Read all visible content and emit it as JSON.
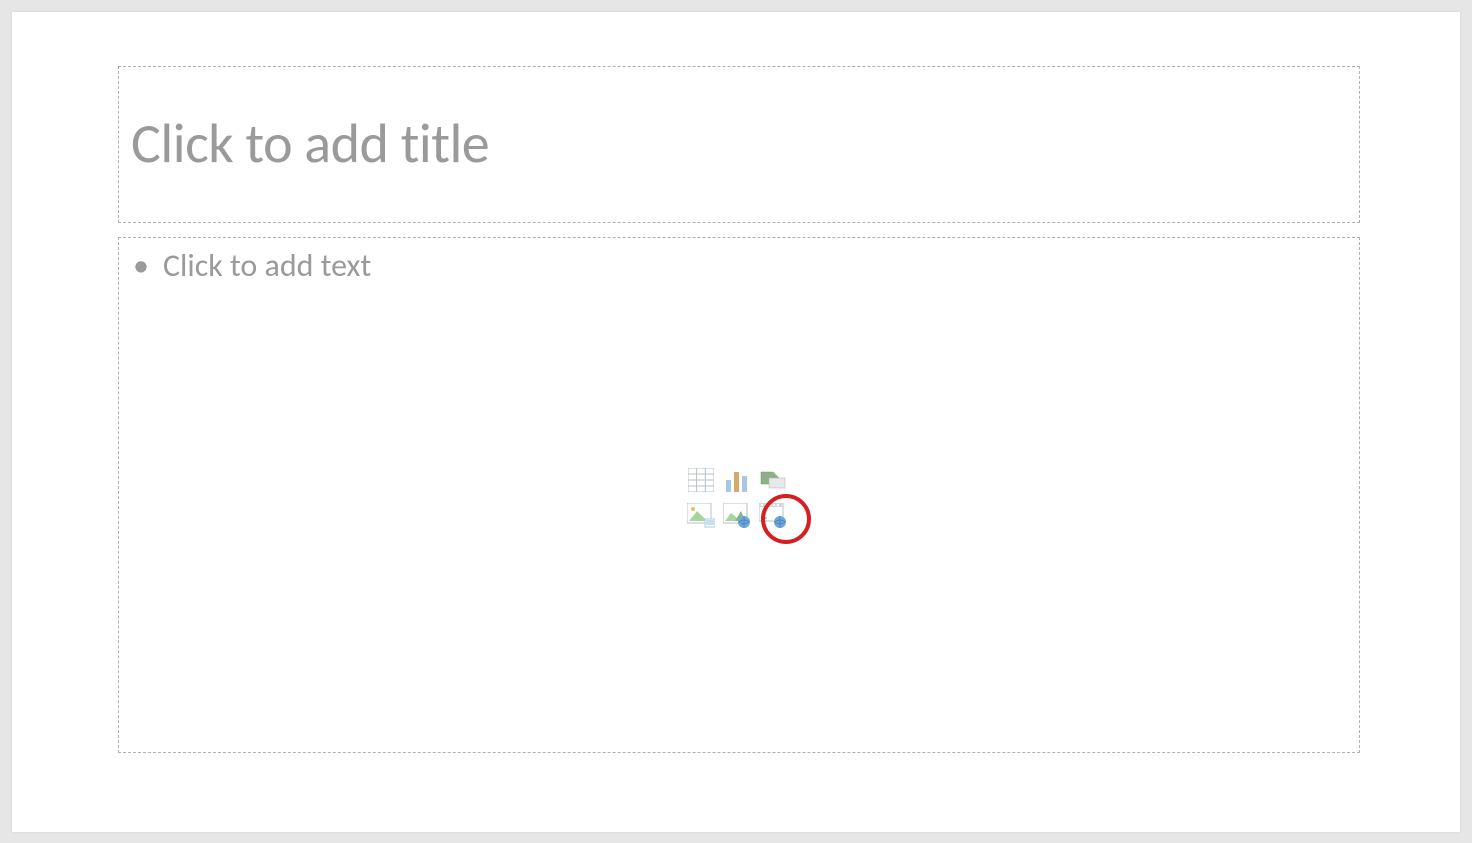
{
  "title": {
    "placeholder": "Click to add title"
  },
  "content": {
    "placeholder": "Click to add text"
  },
  "icons": {
    "table": "table-icon",
    "chart": "chart-icon",
    "smartart": "smartart-icon",
    "pictures": "pictures-icon",
    "online_pictures": "online-pictures-icon",
    "video": "video-icon"
  }
}
